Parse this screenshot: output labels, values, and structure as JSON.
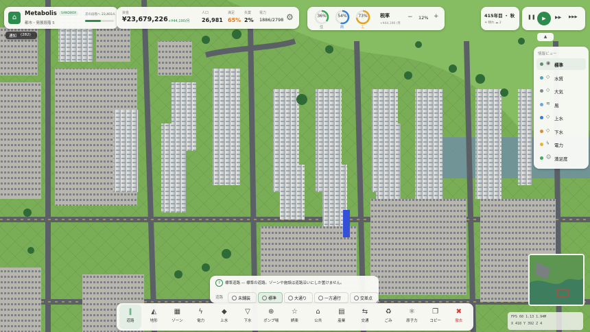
{
  "city": {
    "name": "Metabolis",
    "mode_badge": "SANDBOX",
    "subtitle": "都市・発展段階 5",
    "progress_label": "次の段階へ",
    "progress_value": "23,403人",
    "progress_fraction": 0.55
  },
  "stats": {
    "funds_label": "資金",
    "funds": "¥23,679,226",
    "funds_delta": "+¥44,190/月",
    "population_label": "人口",
    "population": "26,981",
    "happiness_label": "満足",
    "happiness": "65%",
    "unemployment_label": "失業",
    "unemployment": "2%",
    "power_label": "電力",
    "power": "1886/2798"
  },
  "demand": [
    {
      "label": "住",
      "value": "36%",
      "color": "#3aa655",
      "fraction": 0.36
    },
    {
      "label": "商",
      "value": "54%",
      "color": "#3b7fd9",
      "fraction": 0.54
    },
    {
      "label": "工",
      "value": "73%",
      "color": "#e8a21f",
      "fraction": 0.73
    }
  ],
  "tax": {
    "label": "税率",
    "subtext": "+¥44,190 /月",
    "value": "12%",
    "minus": "−",
    "plus": "+"
  },
  "date": {
    "text": "415年目 ・ 秋",
    "weather": "☀ 晴れ ☁ 2"
  },
  "speed": {
    "pause": "❚❚",
    "play": "▶",
    "fast": "▶▶",
    "fastest": "▶▶▶"
  },
  "notify": {
    "label": "通知",
    "count": "282"
  },
  "layers": {
    "title": "情報ビュー",
    "collapse": "▲",
    "items": [
      {
        "label": "標準",
        "icon": "◉",
        "color": "#5b8f6b",
        "active": true
      },
      {
        "label": "水質",
        "icon": "◇",
        "color": "#4aa3c9",
        "active": false
      },
      {
        "label": "大気",
        "icon": "◇",
        "color": "#7c8a94",
        "active": false
      },
      {
        "label": "風",
        "icon": "≋",
        "color": "#6fa6d8",
        "active": false
      },
      {
        "label": "上水",
        "icon": "◇",
        "color": "#2f7fe0",
        "active": false
      },
      {
        "label": "下水",
        "icon": "◇",
        "color": "#e6892a",
        "active": false
      },
      {
        "label": "電力",
        "icon": "ϟ",
        "color": "#e3b52a",
        "active": false
      },
      {
        "label": "満足度",
        "icon": "☺",
        "color": "#3cae5a",
        "active": false
      }
    ]
  },
  "hint": {
    "text": "標準道路 — 標準の道路。ゾーンや施設は道路沿いにしか置けません。",
    "label": "道路",
    "types": [
      "未舗装",
      "標準",
      "大通り",
      "一方通行",
      "交差点"
    ],
    "active_index": 1
  },
  "toolbar": [
    {
      "label": "道路",
      "glyph": "‖",
      "active": true
    },
    {
      "label": "地形",
      "glyph": "◭",
      "active": false
    },
    {
      "label": "ゾーン",
      "glyph": "▦",
      "active": false
    },
    {
      "label": "電力",
      "glyph": "ϟ",
      "active": false
    },
    {
      "label": "上水",
      "glyph": "◆",
      "active": false
    },
    {
      "label": "下水",
      "glyph": "▽",
      "active": false
    },
    {
      "label": "ポンプ場",
      "glyph": "⊕",
      "active": false
    },
    {
      "label": "娯楽",
      "glyph": "☆",
      "active": false
    },
    {
      "label": "公共",
      "glyph": "⌂",
      "active": false
    },
    {
      "label": "産業",
      "glyph": "▤",
      "active": false
    },
    {
      "label": "交通",
      "glyph": "⇆",
      "active": false
    },
    {
      "label": "ごみ",
      "glyph": "♻",
      "active": false
    },
    {
      "label": "原子力",
      "glyph": "⚛",
      "active": false
    },
    {
      "label": "コピー",
      "glyph": "❐",
      "active": false
    },
    {
      "label": "撤去",
      "glyph": "✖",
      "active": false
    }
  ],
  "debug": {
    "line1": "FPS 60     1.13 1.94M",
    "line2": "X 418     Y 392     Z 4"
  },
  "colors": {
    "accent": "#2e8b4e",
    "grass": "#7cb35a",
    "road": "#5b5f66"
  }
}
